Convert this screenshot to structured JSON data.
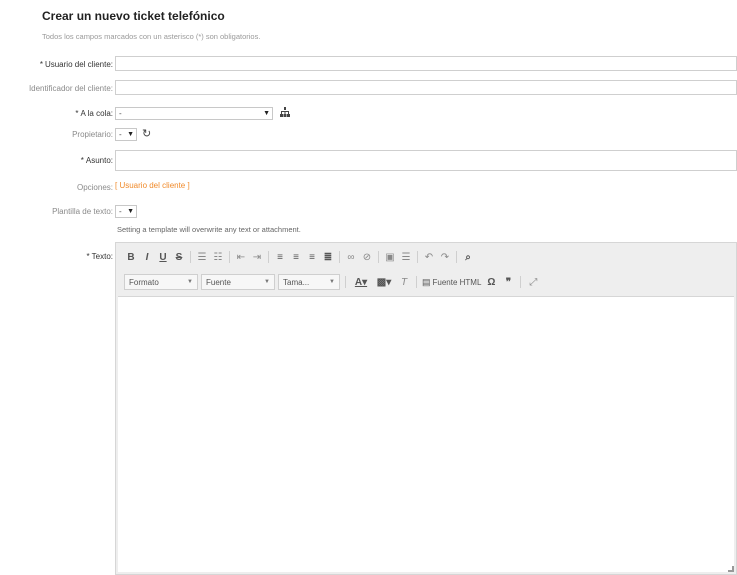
{
  "page": {
    "title": "Crear un nuevo ticket telefónico",
    "subtitle": "Todos los campos marcados con un asterisco (*) son obligatorios."
  },
  "fields": {
    "customer_user": {
      "label": "Usuario del cliente:",
      "required": true,
      "value": ""
    },
    "customer_id": {
      "label": "Identificador del cliente:",
      "required": false,
      "value": ""
    },
    "queue": {
      "label": "A la cola:",
      "required": true,
      "selected": "-"
    },
    "owner": {
      "label": "Propietario:",
      "required": false,
      "selected": "-"
    },
    "subject": {
      "label": "Asunto:",
      "required": true,
      "value": ""
    },
    "options": {
      "label": "Opciones:",
      "link": "[ Usuario del cliente ]"
    },
    "template": {
      "label": "Plantilla de texto:",
      "selected": "-",
      "help": "Setting a template will overwrite any text or attachment."
    },
    "text": {
      "label": "Texto:",
      "required": true
    }
  },
  "required_marker": "*",
  "editor": {
    "format_label": "Formato",
    "font_label": "Fuente",
    "size_label": "Tama...",
    "source_label": "Fuente HTML"
  },
  "colors": {
    "link": "#f08a2a",
    "toolbar_bg": "#eeeeee"
  }
}
